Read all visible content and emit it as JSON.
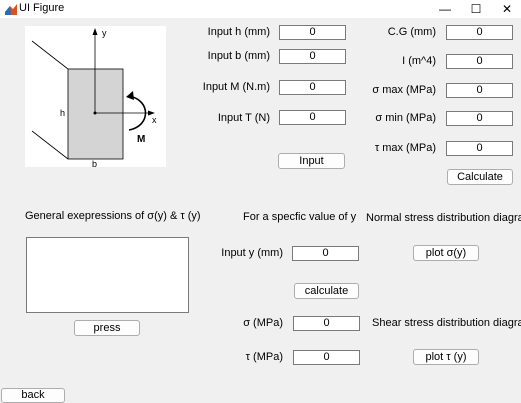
{
  "window": {
    "title": "UI Figure",
    "minimize": "—",
    "maximize": "☐",
    "close": "✕"
  },
  "diagram": {
    "label_y": "y",
    "label_x": "x",
    "label_h": "h",
    "label_b": "b",
    "label_M": "M"
  },
  "inputs": [
    {
      "label": "Input h (mm)",
      "value": "0"
    },
    {
      "label": "Input b (mm)",
      "value": "0"
    },
    {
      "label": "Input M (N.m)",
      "value": "0"
    },
    {
      "label": "Input T (N)",
      "value": "0"
    }
  ],
  "input_button": "Input",
  "outputs": [
    {
      "label": "C.G (mm)",
      "value": "0"
    },
    {
      "label": "I (m^4)",
      "value": "0"
    },
    {
      "label": "σ max (MPa)",
      "value": "0"
    },
    {
      "label": "σ min (MPa)",
      "value": "0"
    },
    {
      "label": "τ max (MPa)",
      "value": "0"
    }
  ],
  "calculate_top_button": "Calculate",
  "general_expr_label": "General exepressions of σ(y) & τ (y)",
  "expr_text": "",
  "press_button": "press",
  "specific_label": "For a specfic value of y",
  "input_y": {
    "label": "Input y (mm)",
    "value": "0"
  },
  "calculate_button": "calculate",
  "sigma": {
    "label": "σ (MPa)",
    "value": "0"
  },
  "tau": {
    "label": "τ (MPa)",
    "value": "0"
  },
  "normal_label": "Normal stress distribution diagram",
  "plot_sigma_button": "plot σ(y)",
  "shear_label": "Shear stress distribution diagram",
  "plot_tau_button": "plot τ (y)",
  "back_button": "back"
}
